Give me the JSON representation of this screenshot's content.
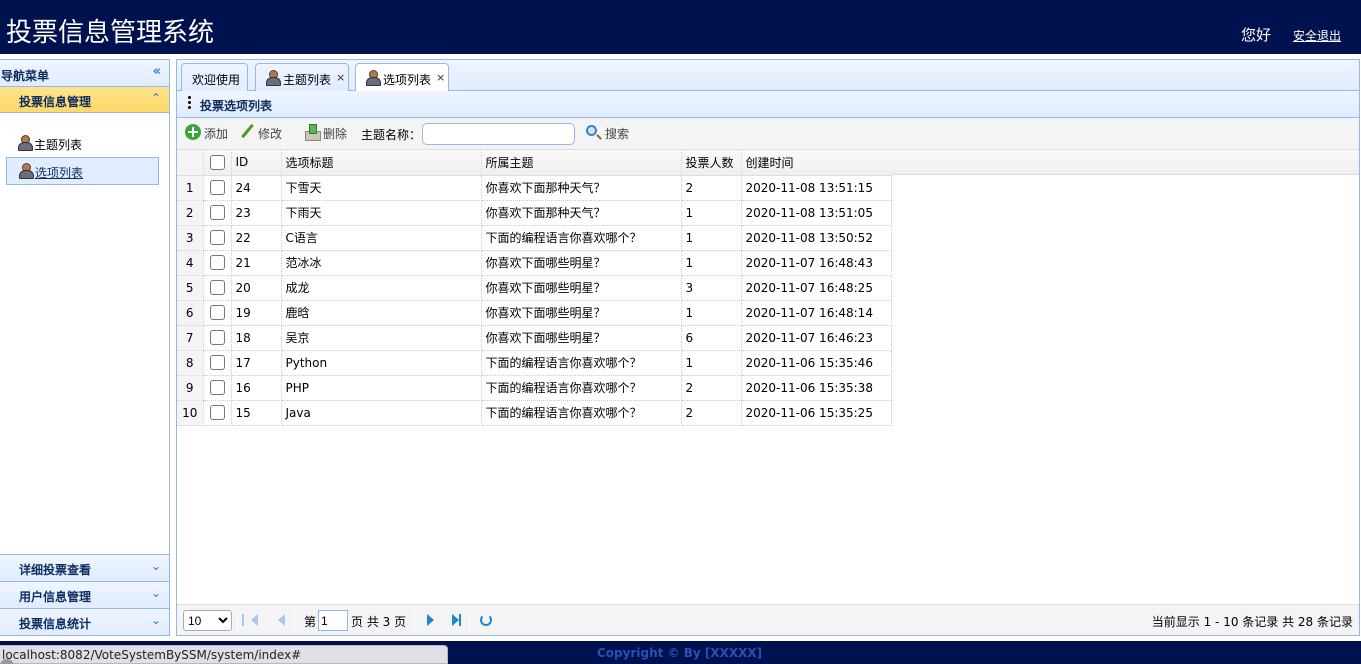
{
  "header": {
    "title": "投票信息管理系统",
    "greeting": "您好",
    "logout": "安全退出"
  },
  "sidebar": {
    "nav_title": "导航菜单",
    "active_group": {
      "label": "投票信息管理",
      "items": [
        {
          "label": "主题列表",
          "icon": "user-icon"
        },
        {
          "label": "选项列表",
          "icon": "user-icon",
          "selected": true
        }
      ]
    },
    "groups": [
      {
        "label": "详细投票查看"
      },
      {
        "label": "用户信息管理"
      },
      {
        "label": "投票信息统计"
      }
    ]
  },
  "tabs": [
    {
      "label": "欢迎使用",
      "closable": false
    },
    {
      "label": "主题列表",
      "closable": true,
      "icon": "user-icon"
    },
    {
      "label": "选项列表",
      "closable": true,
      "icon": "user-icon",
      "active": true
    }
  ],
  "panel": {
    "title": "投票选项列表"
  },
  "toolbar": {
    "add": "添加",
    "edit": "修改",
    "delete": "删除",
    "search_label": "主题名称：",
    "search_value": "",
    "search_button": "搜索"
  },
  "grid": {
    "columns": [
      "ID",
      "选项标题",
      "所属主题",
      "投票人数",
      "创建时间"
    ],
    "rows": [
      {
        "n": "1",
        "id": "24",
        "title": "下雪天",
        "topic": "你喜欢下面那种天气？",
        "votes": "2",
        "created": "2020-11-08 13:51:15"
      },
      {
        "n": "2",
        "id": "23",
        "title": "下雨天",
        "topic": "你喜欢下面那种天气？",
        "votes": "1",
        "created": "2020-11-08 13:51:05"
      },
      {
        "n": "3",
        "id": "22",
        "title": "C语言",
        "topic": "下面的编程语言你喜欢哪个？",
        "votes": "1",
        "created": "2020-11-08 13:50:52"
      },
      {
        "n": "4",
        "id": "21",
        "title": "范冰冰",
        "topic": "你喜欢下面哪些明星？",
        "votes": "1",
        "created": "2020-11-07 16:48:43"
      },
      {
        "n": "5",
        "id": "20",
        "title": "成龙",
        "topic": "你喜欢下面哪些明星？",
        "votes": "3",
        "created": "2020-11-07 16:48:25"
      },
      {
        "n": "6",
        "id": "19",
        "title": "鹿晗",
        "topic": "你喜欢下面哪些明星？",
        "votes": "1",
        "created": "2020-11-07 16:48:14"
      },
      {
        "n": "7",
        "id": "18",
        "title": "吴京",
        "topic": "你喜欢下面哪些明星？",
        "votes": "6",
        "created": "2020-11-07 16:46:23"
      },
      {
        "n": "8",
        "id": "17",
        "title": "Python",
        "topic": "下面的编程语言你喜欢哪个？",
        "votes": "1",
        "created": "2020-11-06 15:35:46"
      },
      {
        "n": "9",
        "id": "16",
        "title": "PHP",
        "topic": "下面的编程语言你喜欢哪个？",
        "votes": "2",
        "created": "2020-11-06 15:35:38"
      },
      {
        "n": "10",
        "id": "15",
        "title": "Java",
        "topic": "下面的编程语言你喜欢哪个？",
        "votes": "2",
        "created": "2020-11-06 15:35:25"
      }
    ]
  },
  "pager": {
    "page_size": "10",
    "page_label_before": "第",
    "current_page": "1",
    "page_label_after": "页 共 3 页",
    "info": "当前显示 1 - 10 条记录 共 28 条记录"
  },
  "footer": {
    "copyright": "Copyright © By  [XXXXX]"
  },
  "status_bar": {
    "url": "localhost:8082/VoteSystemBySSM/system/index#"
  },
  "colors": {
    "header_bg": "#00114f",
    "accent_border": "#95b8e7",
    "active_group_bg": "#ffd869"
  }
}
